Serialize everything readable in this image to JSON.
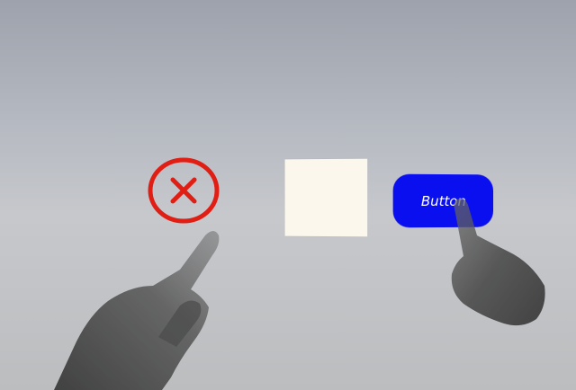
{
  "scene": {
    "close_icon_name": "close-circle-icon",
    "close_color": "#e01e14",
    "panel_color": "#fbf7ec",
    "button": {
      "label": "Button",
      "color": "#0a0ff0"
    },
    "hands": [
      "left-hand",
      "right-hand"
    ]
  }
}
